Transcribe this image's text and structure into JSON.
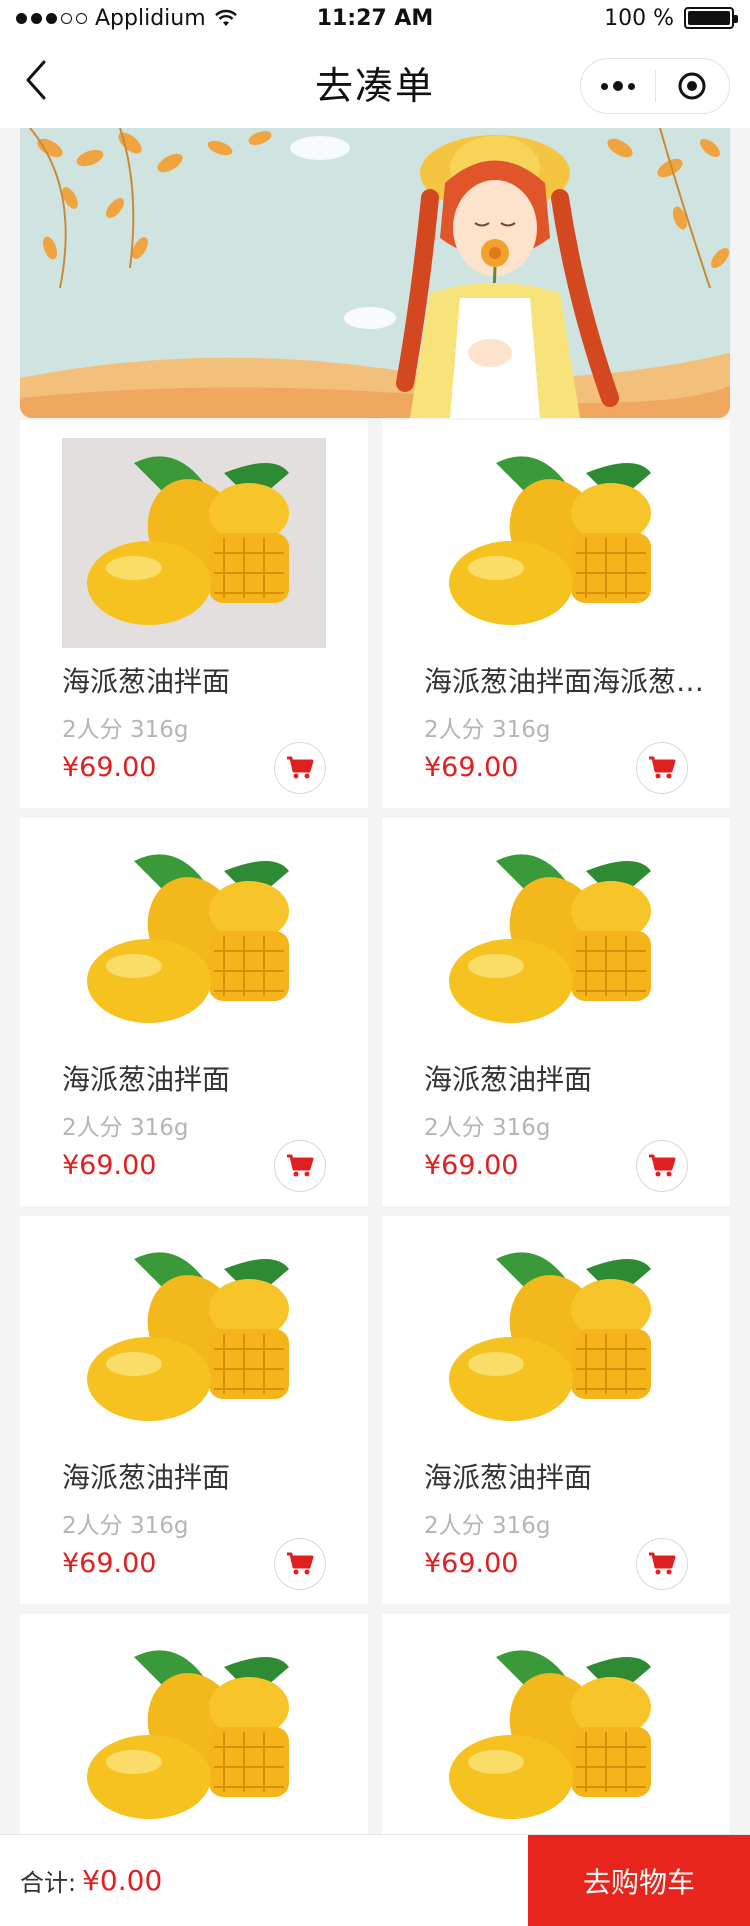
{
  "status_bar": {
    "carrier": "Applidium",
    "time": "11:27 AM",
    "battery": "100 %"
  },
  "nav": {
    "title": "去凑单",
    "back_icon": "chevron-left-icon",
    "more_icon": "more-dots-icon",
    "close_icon": "target-circle-icon"
  },
  "products": [
    {
      "name": "海派葱油拌面",
      "spec": "2人分 316g",
      "price": "¥69.00"
    },
    {
      "name": "海派葱油拌面海派葱油拌面",
      "spec": "2人分 316g",
      "price": "¥69.00"
    },
    {
      "name": "海派葱油拌面",
      "spec": "2人分 316g",
      "price": "¥69.00"
    },
    {
      "name": "海派葱油拌面",
      "spec": "2人分 316g",
      "price": "¥69.00"
    },
    {
      "name": "海派葱油拌面",
      "spec": "2人分 316g",
      "price": "¥69.00"
    },
    {
      "name": "海派葱油拌面",
      "spec": "2人分 316g",
      "price": "¥69.00"
    },
    {
      "name": "",
      "spec": "",
      "price": ""
    },
    {
      "name": "",
      "spec": "",
      "price": ""
    }
  ],
  "footer": {
    "total_label": "合计:",
    "total_value": "¥0.00",
    "checkout_label": "去购物车"
  },
  "colors": {
    "accent": "#e8251c",
    "price": "#e02020",
    "spec": "#b5b5b5"
  }
}
